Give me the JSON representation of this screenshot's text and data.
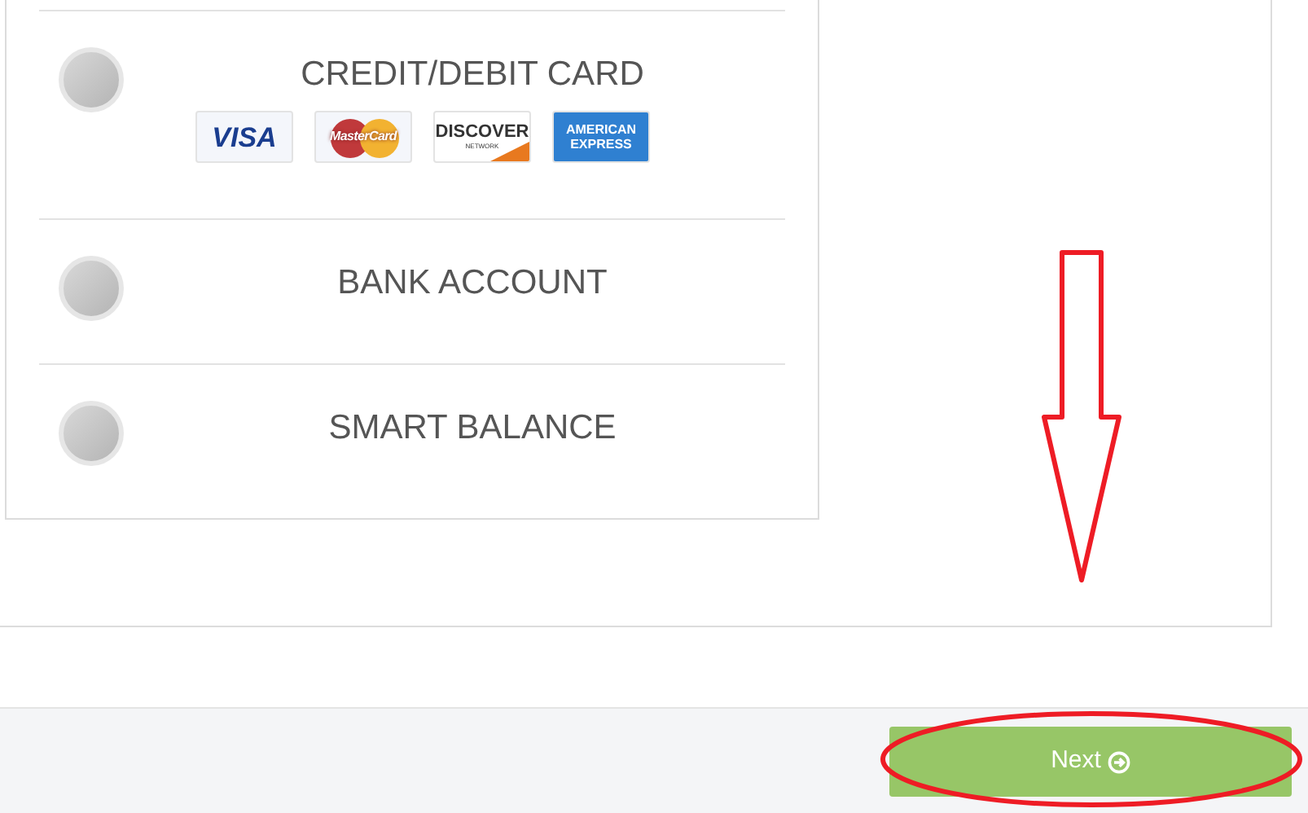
{
  "payment_options": [
    {
      "label": "CREDIT/DEBIT CARD",
      "selected": false,
      "card_logos": [
        {
          "kind": "visa",
          "lines": [
            "VISA"
          ]
        },
        {
          "kind": "mastercard",
          "lines": [
            "MasterCard"
          ]
        },
        {
          "kind": "discover",
          "lines": [
            "DISCOVER",
            "NETWORK"
          ]
        },
        {
          "kind": "amex",
          "lines": [
            "AMERICAN",
            "EXPRESS"
          ]
        }
      ]
    },
    {
      "label": "BANK ACCOUNT",
      "selected": false
    },
    {
      "label": "SMART BALANCE",
      "selected": false
    }
  ],
  "next_button": {
    "label": "Next"
  }
}
